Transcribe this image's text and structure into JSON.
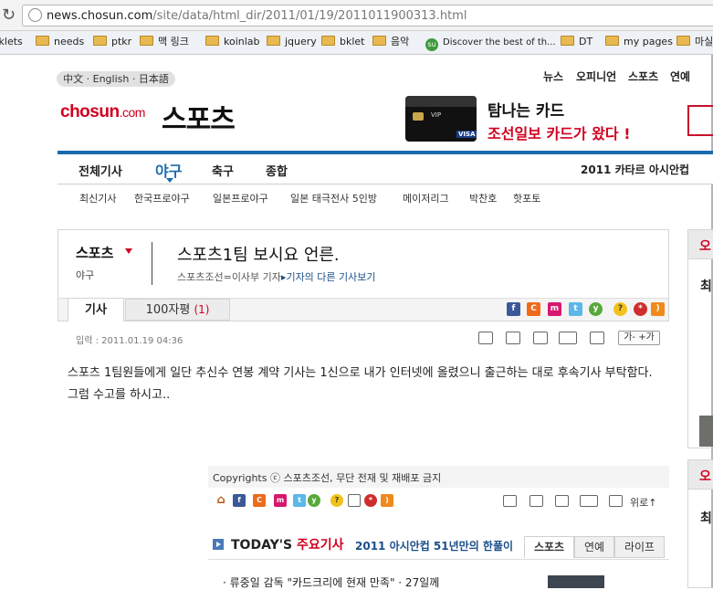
{
  "browser": {
    "url_host": "news.chosun.com",
    "url_path": "/site/data/html_dir/2011/01/19/2011011900313.html",
    "bookmarks": [
      {
        "label": "rklets",
        "type": "plain"
      },
      {
        "label": "needs",
        "type": "folder"
      },
      {
        "label": "ptkr",
        "type": "folder"
      },
      {
        "label": "맥 링크",
        "type": "folder"
      },
      {
        "label": "koinlab",
        "type": "folder"
      },
      {
        "label": "jquery",
        "type": "folder"
      },
      {
        "label": "bklet",
        "type": "folder"
      },
      {
        "label": "음악",
        "type": "folder"
      },
      {
        "label": "Discover the best of th...",
        "type": "stumbleupon"
      },
      {
        "label": "DT",
        "type": "folder"
      },
      {
        "label": "my pages",
        "type": "folder"
      },
      {
        "label": "마실",
        "type": "folder"
      }
    ]
  },
  "header": {
    "lang_button": "中文 · English · 日本語",
    "top_nav": [
      "뉴스",
      "오피니언",
      "스포츠",
      "연예"
    ],
    "logo_main": "chosun",
    "logo_dotcom": ".com",
    "logo_section": "스포츠",
    "ad": {
      "title": "탐나는 카드",
      "subtitle": "조선일보 카드가 왔다 !",
      "card_text": "VIP",
      "card_brand": "VISA"
    }
  },
  "nav": {
    "items": [
      "전체기사",
      "야구",
      "축구",
      "종합"
    ],
    "active": "야구",
    "right_text": "2011 카타르 아시안컵",
    "sub_items": [
      "최신기사",
      "한국프로야구",
      "일본프로야구",
      "일본 태극전사 5인방",
      "메이저리그",
      "박찬호",
      "핫포토"
    ]
  },
  "article": {
    "section": "스포츠",
    "subsection": "야구",
    "headline": "스포츠1팀 보시요 언른.",
    "byline": "스포츠조선=이사부 기자",
    "byline_more": "▸기자의 다른 기사보기",
    "tab_article": "기사",
    "tab_comments": "100자평",
    "comment_count": "(1)",
    "date": "입력 : 2011.01.19 04:36",
    "font_control": "가- +가",
    "body": "스포츠 1팀원들에게 일단 추신수 연봉 계약 기사는 1신으로 내가 인터넷에 올렸으니 출근하는 대로 후속기사 부탁함다. 그럼 수고를 하시고..",
    "copyright": "Copyrights ⓒ 스포츠조선, 무단 전재 및 재배포 금지",
    "to_top": "위로↑"
  },
  "today": {
    "title_en": "TODAY'S",
    "title_ko": "주요기사",
    "headline": "2011 아시안컵 51년만의 한풀이",
    "tabs": [
      "스포츠",
      "연예",
      "라이프"
    ],
    "next_item": "· 류중일 감독 \"카드크리에 현재 만족\" · 27일께"
  },
  "sidebar": {
    "head1": "오",
    "head2": "오",
    "glyphs": [
      "최",
      "최"
    ]
  },
  "colors": {
    "brand_red": "#d1001f",
    "nav_blue": "#1b6aac",
    "link_blue": "#1b4f8a"
  }
}
